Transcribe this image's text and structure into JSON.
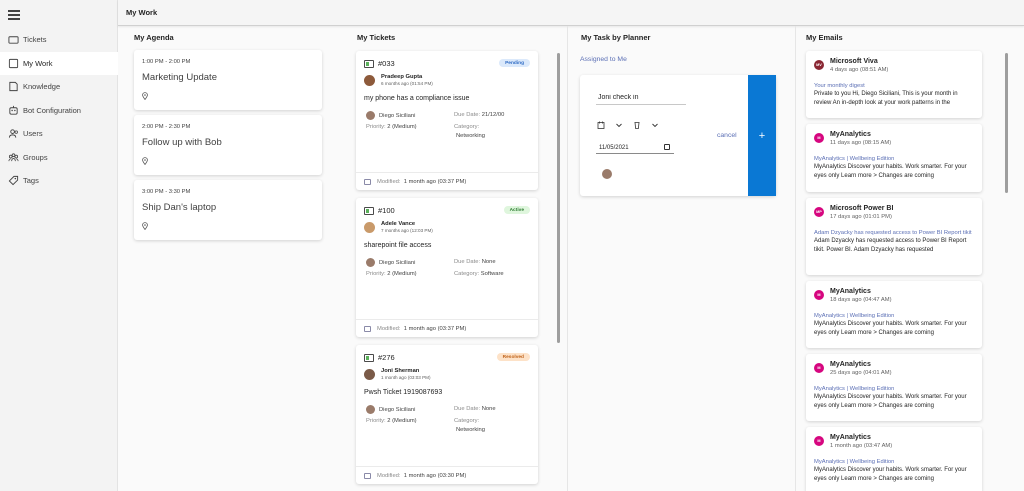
{
  "sidebar": {
    "items": [
      {
        "label": "Tickets",
        "icon": "ticket-icon"
      },
      {
        "label": "My Work",
        "icon": "work-icon"
      },
      {
        "label": "Knowledge",
        "icon": "book-icon"
      },
      {
        "label": "Bot Configuration",
        "icon": "bot-icon"
      },
      {
        "label": "Users",
        "icon": "users-icon"
      },
      {
        "label": "Groups",
        "icon": "groups-icon"
      },
      {
        "label": "Tags",
        "icon": "tag-icon"
      }
    ],
    "active": "My Work"
  },
  "header": {
    "title": "My Work"
  },
  "agenda": {
    "title": "My Agenda",
    "items": [
      {
        "time": "1:00 PM - 2:00 PM",
        "title": "Marketing Update"
      },
      {
        "time": "2:00 PM - 2:30 PM",
        "title": "Follow up with Bob"
      },
      {
        "time": "3:00 PM - 3:30 PM",
        "title": "Ship Dan's laptop"
      }
    ]
  },
  "tickets": {
    "title": "My Tickets",
    "items": [
      {
        "id": "#033",
        "status": "Pending",
        "requester": "Pradeep Gupta",
        "requested": "6 months ago (01:54 PM)",
        "subject": "my phone has a compliance issue",
        "assignee": "Diego Siciliani",
        "due_label": "Due Date:",
        "due": "21/12/00",
        "priority_label": "Priority:",
        "priority": "2 (Medium)",
        "category_label": "Category:",
        "category": "Networking",
        "modified_label": "Modified:",
        "modified": "1 month ago (03:37 PM)"
      },
      {
        "id": "#100",
        "status": "Active",
        "requester": "Adele Vance",
        "requested": "7 months ago (12:03 PM)",
        "subject": "sharepoint file access",
        "assignee": "Diego Siciliani",
        "due_label": "Due Date:",
        "due": "None",
        "priority_label": "Priority:",
        "priority": "2 (Medium)",
        "category_label": "Category:",
        "category": "Software",
        "modified_label": "Modified:",
        "modified": "1 month ago (03:37 PM)"
      },
      {
        "id": "#276",
        "status": "Resolved",
        "requester": "Joni Sherman",
        "requested": "1 month ago (03:03 PM)",
        "subject": "Pwsh Ticket 1919087693",
        "assignee": "Diego Siciliani",
        "due_label": "Due Date:",
        "due": "None",
        "priority_label": "Priority:",
        "priority": "2 (Medium)",
        "category_label": "Category:",
        "category": "Networking",
        "modified_label": "Modified:",
        "modified": "1 month ago (03:30 PM)"
      }
    ]
  },
  "planner": {
    "title": "My Task by Planner",
    "filter_link": "Assigned to Me",
    "task_name": "Joni check in",
    "date": "11/05/2021",
    "cancel": "cancel",
    "add": "+"
  },
  "emails": {
    "title": "My Emails",
    "items": [
      {
        "initials": "MV",
        "color": "#8a2733",
        "sender": "Microsoft Viva",
        "time": "4 days ago (08:51 AM)",
        "subject": "Your monthly digest",
        "body": "Private to you Hi, Diego Siciliani, This is your month in review An in-depth look at your work patterns in the"
      },
      {
        "initials": "M",
        "color": "#d6067f",
        "sender": "MyAnalytics",
        "time": "11 days ago (08:15 AM)",
        "subject": "MyAnalytics | Wellbeing Edition",
        "body": "MyAnalytics Discover your habits. Work smarter. For your eyes only Learn more > Changes are coming"
      },
      {
        "initials": "MP",
        "color": "#d6067f",
        "sender": "Microsoft Power BI",
        "time": "17 days ago (01:01 PM)",
        "subject": "Adam Dzyacky has requested access to Power BI Report tikit",
        "body": "Adam Dzyacky has requested access to Power BI Report tikit. Power BI. Adam Dzyacky has requested"
      },
      {
        "initials": "M",
        "color": "#d6067f",
        "sender": "MyAnalytics",
        "time": "18 days ago (04:47 AM)",
        "subject": "MyAnalytics | Wellbeing Edition",
        "body": "MyAnalytics Discover your habits. Work smarter. For your eyes only Learn more > Changes are coming"
      },
      {
        "initials": "M",
        "color": "#d6067f",
        "sender": "MyAnalytics",
        "time": "25 days ago (04:01 AM)",
        "subject": "MyAnalytics | Wellbeing Edition",
        "body": "MyAnalytics Discover your habits. Work smarter. For your eyes only Learn more > Changes are coming"
      },
      {
        "initials": "M",
        "color": "#d6067f",
        "sender": "MyAnalytics",
        "time": "1 month ago (03:47 AM)",
        "subject": "MyAnalytics | Wellbeing Edition",
        "body": "MyAnalytics Discover your habits. Work smarter. For your eyes only Learn more > Changes are coming"
      }
    ]
  },
  "colors": {
    "accent": "#0a78d4",
    "link": "#5b6fb5",
    "badge_pending_bg": "#dbe9fb",
    "badge_pending_fg": "#2f6bc4",
    "badge_active_bg": "#dff6dd",
    "badge_active_fg": "#2e7d32",
    "badge_resolved_bg": "#fde2c8",
    "badge_resolved_fg": "#c0631a"
  }
}
